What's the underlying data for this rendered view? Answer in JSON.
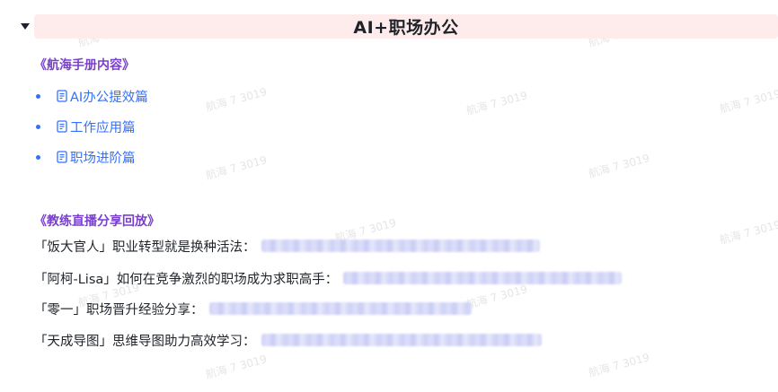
{
  "heading": {
    "title": "AI+职场办公",
    "toggle_icon": "caret-down-icon"
  },
  "handbook": {
    "title": "《航海手册内容》",
    "items": [
      {
        "label": "AI办公提效篇",
        "icon": "doc-icon"
      },
      {
        "label": "工作应用篇",
        "icon": "doc-icon"
      },
      {
        "label": "职场进阶篇",
        "icon": "doc-icon"
      }
    ]
  },
  "replays": {
    "title": "《教练直播分享回放》",
    "items": [
      {
        "text": "「饭大官人」职业转型就是换种活法："
      },
      {
        "text": "「阿柯-Lisa」如何在竞争激烈的职场成为求职高手："
      },
      {
        "text": "「零一」职场晋升经验分享："
      },
      {
        "text": "「天成导图」思维导图助力高效学习："
      }
    ]
  },
  "watermark": {
    "text": "航海 7 3019"
  },
  "colors": {
    "heading_bg": "#fdeceb",
    "section_title": "#7b3fd0",
    "link": "#3370ff",
    "text": "#1f2329"
  }
}
